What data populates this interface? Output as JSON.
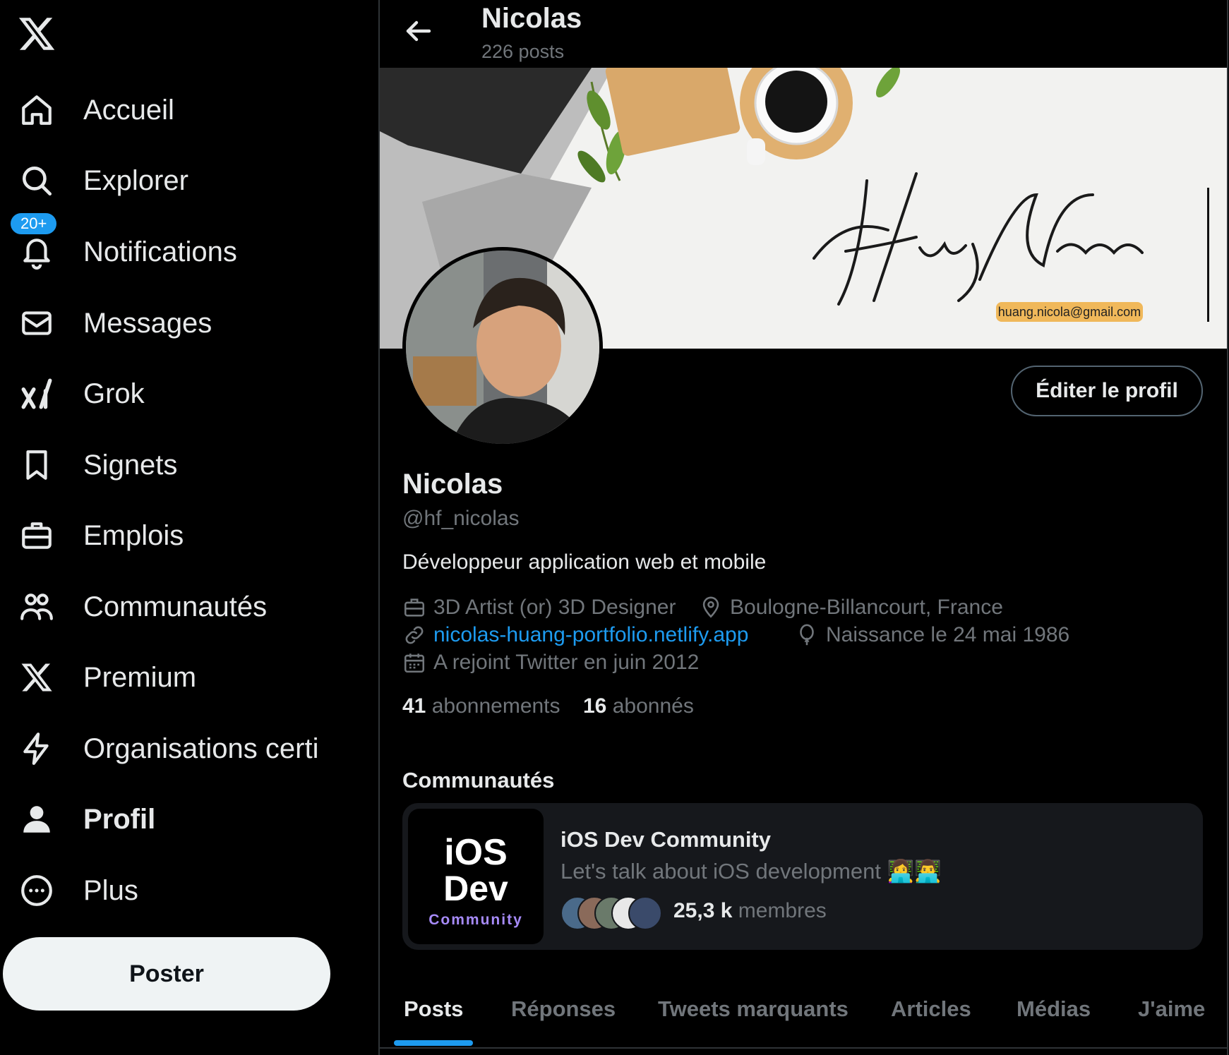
{
  "sidebar": {
    "logo_icon": "x-logo-icon",
    "items": [
      {
        "label": "Accueil",
        "icon": "home-icon"
      },
      {
        "label": "Explorer",
        "icon": "search-icon"
      },
      {
        "label": "Notifications",
        "icon": "bell-icon",
        "badge": "20+"
      },
      {
        "label": "Messages",
        "icon": "envelope-icon"
      },
      {
        "label": "Grok",
        "icon": "grok-icon"
      },
      {
        "label": "Signets",
        "icon": "bookmark-icon"
      },
      {
        "label": "Emplois",
        "icon": "briefcase-icon"
      },
      {
        "label": "Communautés",
        "icon": "people-icon"
      },
      {
        "label": "Premium",
        "icon": "x-logo-icon"
      },
      {
        "label": "Organisations certi",
        "icon": "lightning-icon"
      },
      {
        "label": "Profil",
        "icon": "person-icon"
      },
      {
        "label": "Plus",
        "icon": "more-circle-icon"
      }
    ],
    "active_item": "Profil",
    "post_label": "Poster"
  },
  "header": {
    "name": "Nicolas",
    "post_count": "226 posts"
  },
  "banner": {
    "signature": "Huang Nicolas",
    "email": "huang.nicola@gmail.com"
  },
  "profile": {
    "edit_label": "Éditer le profil",
    "name": "Nicolas",
    "handle": "@hf_nicolas",
    "bio": "Développeur application web et mobile",
    "job": "3D Artist (or) 3D Designer",
    "location": "Boulogne-Billancourt, France",
    "website": "nicolas-huang-portfolio.netlify.app",
    "birth": "Naissance le 24 mai 1986",
    "joined": "A rejoint Twitter en juin 2012",
    "following_count": "41",
    "following_label": "abonnements",
    "followers_count": "16",
    "followers_label": "abonnés"
  },
  "communities": {
    "heading": "Communautés",
    "card": {
      "image_line1": "iOS",
      "image_line2": "Dev",
      "image_line3": "Community",
      "name": "iOS Dev Community",
      "description": "Let's talk about iOS development 👩‍💻👨‍💻",
      "member_count": "25,3 k",
      "member_label": "membres"
    }
  },
  "tabs": [
    "Posts",
    "Réponses",
    "Tweets marquants",
    "Articles",
    "Médias",
    "J'aime"
  ],
  "active_tab": "Posts",
  "colors": {
    "background": "#000000",
    "accent": "#1d9bf0",
    "text": "#e7e9ea",
    "muted": "#71767b",
    "email_tag": "#f0b85a"
  }
}
